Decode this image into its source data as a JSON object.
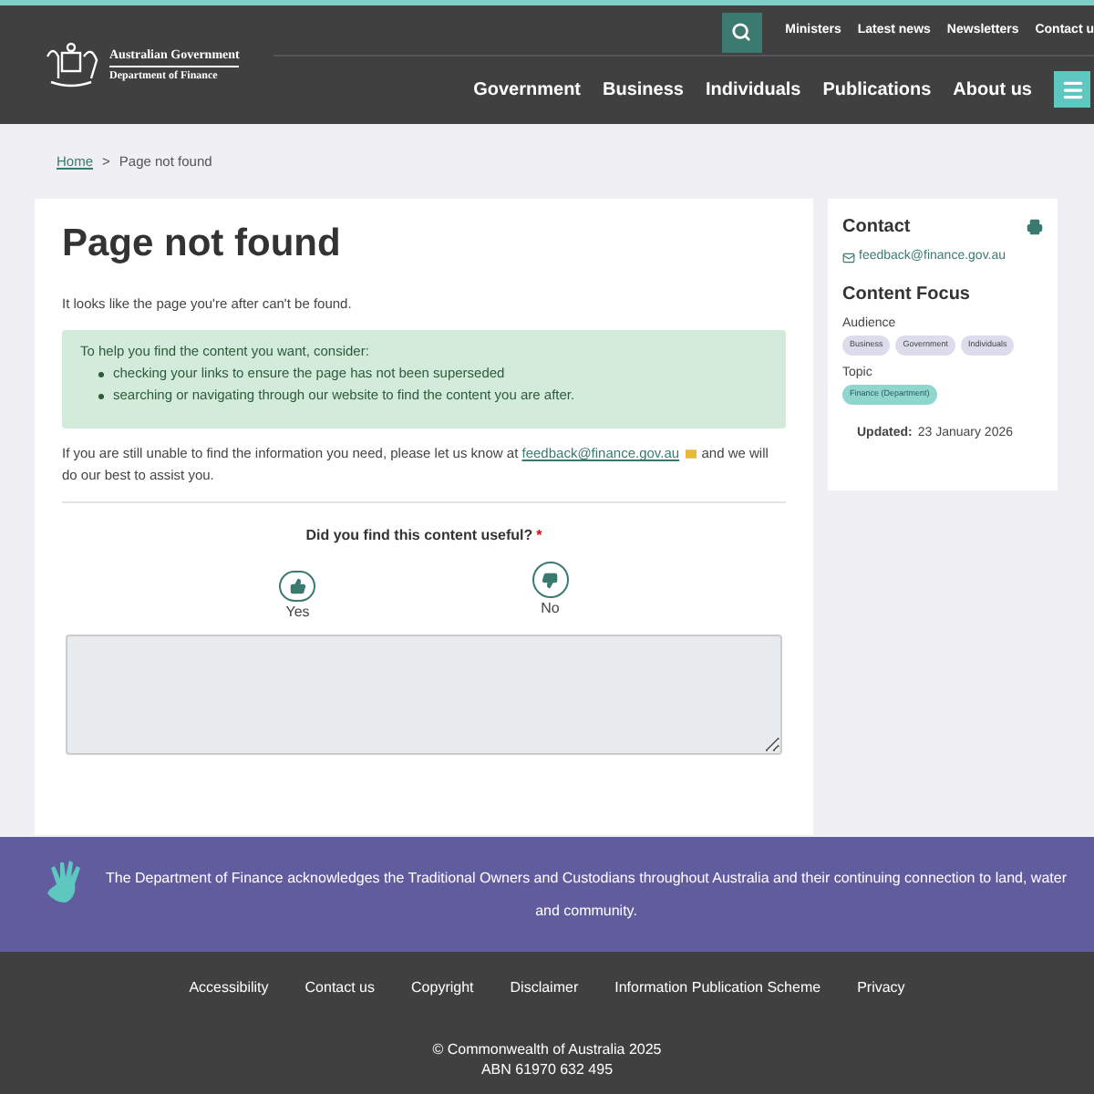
{
  "header": {
    "logo": {
      "line_1": "Australian Government",
      "line_2": "Department of Finance"
    },
    "utility_links": [
      "Ministers",
      "Latest news",
      "Newsletters",
      "Contact u"
    ],
    "nav": [
      "Government",
      "Business",
      "Individuals",
      "Publications",
      "About us"
    ]
  },
  "breadcrumb": {
    "link": "Home",
    "separator": ">",
    "current": "Page not found"
  },
  "main": {
    "title": "Page not found",
    "intro": "It looks like the page you're after can't be found.",
    "notice": {
      "lead": "To help you find the content you want, consider:",
      "items": [
        "checking your links to ensure the page has not been superseded",
        "searching or navigating through our website to find the content you are after."
      ]
    },
    "contact_text_before": "If you are still unable to find the information you need, please let us know at",
    "contact_email": "feedback@finance.gov.au",
    "contact_text_after": "and we will do our best to assist you.",
    "feedback": {
      "question": "Did you find this content useful?",
      "required_mark": "*",
      "options": [
        {
          "kind": "yes",
          "label": "Yes",
          "selected": false
        },
        {
          "kind": "no",
          "label": "No",
          "selected": false
        }
      ]
    }
  },
  "sidebar": {
    "contact_heading": "Contact",
    "email": "feedback@finance.gov.au",
    "focus_heading": "Content Focus",
    "audience_label": "Audience",
    "audience_tags": [
      "Business",
      "Government",
      "Individuals"
    ],
    "topic_label": "Topic",
    "topic_tags": [
      "Finance (Department)"
    ],
    "updated_label": "Updated:",
    "updated_date": "23 January 2026"
  },
  "acknowledgement": "The Department of Finance acknowledges the Traditional Owners and Custodians throughout Australia and their continuing connection to land, water and community.",
  "footer": {
    "links": [
      "Accessibility",
      "Contact us",
      "Copyright",
      "Disclaimer",
      "Information Publication Scheme",
      "Privacy"
    ],
    "copyright": "© Commonwealth of Australia 2025",
    "abn": "ABN 61970 632 495"
  }
}
